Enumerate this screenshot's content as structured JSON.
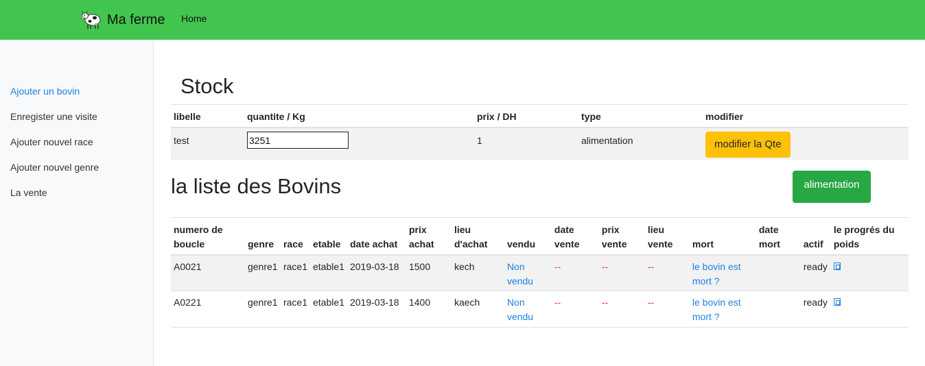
{
  "navbar": {
    "brand": "Ma ferme",
    "home": "Home"
  },
  "sidebar": {
    "items": [
      {
        "label": "Ajouter un bovin"
      },
      {
        "label": "Enregister une visite"
      },
      {
        "label": "Ajouter nouvel race"
      },
      {
        "label": "Ajouter nouvel genre"
      },
      {
        "label": "La vente"
      }
    ]
  },
  "stock": {
    "title": "Stock",
    "headers": [
      "libelle",
      "quantite / Kg",
      "prix / DH",
      "type",
      "modifier"
    ],
    "row": {
      "libelle": "test",
      "quantite": "3251",
      "prix": "1",
      "type": "alimentation",
      "button": "modifier la Qte"
    }
  },
  "bovins": {
    "title": "la liste des Bovins",
    "alimentation_button": "alimentation",
    "headers": [
      "numero de boucle",
      "genre",
      "race",
      "etable",
      "date achat",
      "prix achat",
      "lieu d'achat",
      "vendu",
      "date vente",
      "prix vente",
      "lieu vente",
      "mort",
      "date mort",
      "actif",
      "le progrés du poids"
    ],
    "rows": [
      {
        "numero": "A0021",
        "genre": "genre1",
        "race": "race1",
        "etable": "etable1",
        "date_achat": "2019-03-18",
        "prix_achat": "1500",
        "lieu_achat": "kech",
        "vendu": "Non vendu",
        "date_vente": "--",
        "prix_vente": "--",
        "lieu_vente": "--",
        "mort": "le bovin est mort ?",
        "date_mort": "",
        "actif": "ready",
        "poids_icon": "image-icon"
      },
      {
        "numero": "A0221",
        "genre": "genre1",
        "race": "race1",
        "etable": "etable1",
        "date_achat": "2019-03-18",
        "prix_achat": "1400",
        "lieu_achat": "kaech",
        "vendu": "Non vendu",
        "date_vente": "--",
        "prix_vente": "--",
        "lieu_vente": "--",
        "mort": "le bovin est mort ?",
        "date_mort": "",
        "actif": "ready",
        "poids_icon": "image-icon"
      }
    ]
  },
  "colors": {
    "navbar": "#42c54e",
    "link": "#1e80e0",
    "warning": "#ffc107",
    "success": "#28a745",
    "dash": "#dc3545"
  }
}
